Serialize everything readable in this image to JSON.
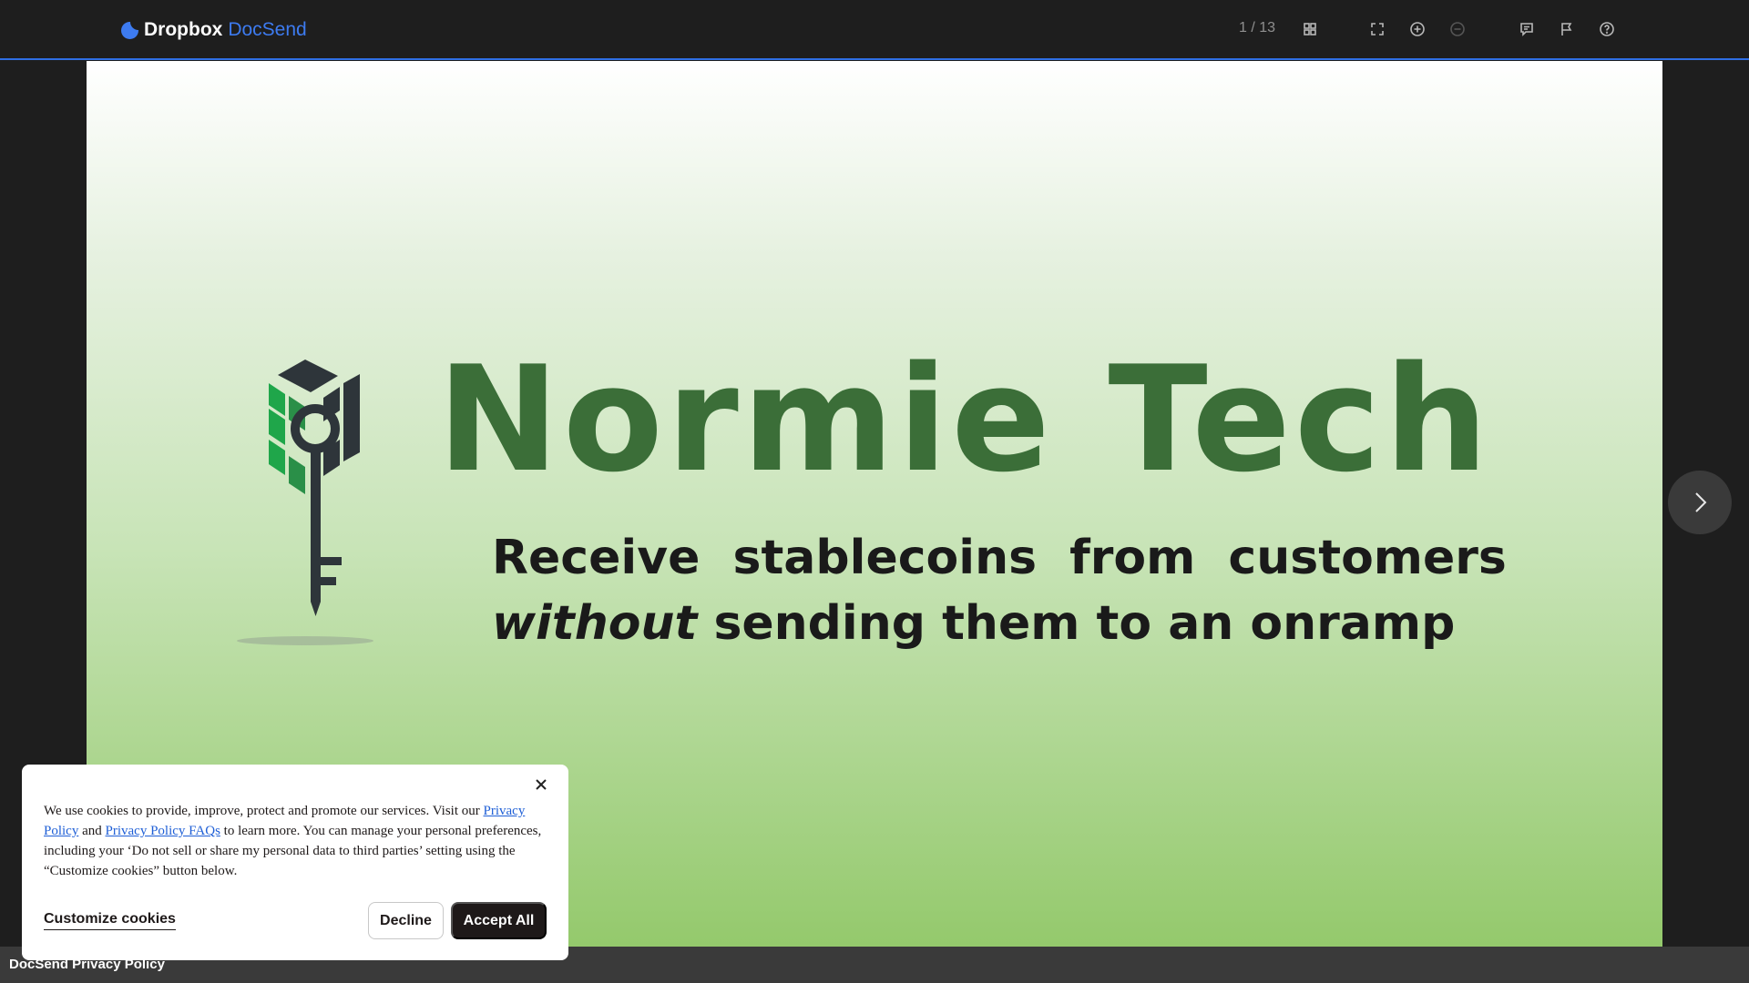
{
  "header": {
    "brand_primary": "Dropbox",
    "brand_secondary": "DocSend",
    "page_indicator": "1 / 13",
    "tools": [
      "grid-view-icon",
      "fullscreen-icon",
      "zoom-in-icon",
      "zoom-out-icon",
      "comment-icon",
      "flag-icon",
      "help-icon"
    ]
  },
  "slide": {
    "title": "Normie Tech",
    "subtitle_line1": "Receive stablecoins from customers",
    "subtitle_italic": "without",
    "subtitle_line2_rest": " sending them to an onramp",
    "colors": {
      "title": "#3b6e38",
      "gradient_top": "#ffffff",
      "gradient_bottom": "#94c96c"
    }
  },
  "footer": {
    "privacy_link": "DocSend Privacy Policy"
  },
  "cookie_banner": {
    "text_part1": "We use cookies to provide, improve, protect and promote our services. Visit our ",
    "link1": "Privacy Policy",
    "text_and": " and ",
    "link2": "Privacy Policy FAQs",
    "text_part2": " to learn more. You can manage your personal preferences, including your ‘Do not sell or share my personal data to third parties’ setting using the “Customize cookies” button below.",
    "customize_label": "Customize cookies",
    "decline_label": "Decline",
    "accept_label": "Accept All"
  },
  "accent_color": "#2f6fe4"
}
